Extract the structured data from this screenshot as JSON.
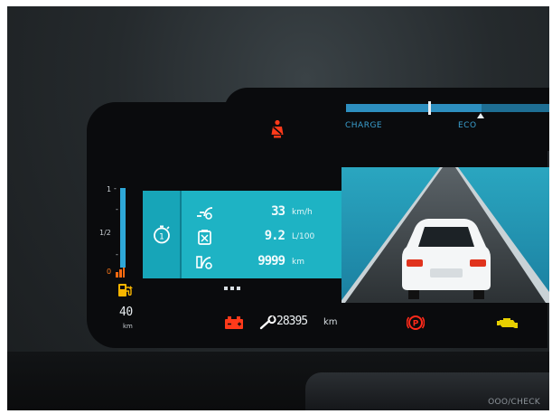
{
  "top_bar": {
    "charge_label": "CHARGE",
    "eco_label": "ECO",
    "charge_level_percent": 40
  },
  "fuel_gauge": {
    "tick_full": "1",
    "tick_half": "1/2",
    "tick_empty": "0",
    "range_value": "40",
    "range_unit": "km"
  },
  "trip": {
    "rows": [
      {
        "icon": "average-speed-icon",
        "value": "33",
        "unit": "km/h"
      },
      {
        "icon": "fuel-consumption-icon",
        "value": "9.2",
        "unit": "L/100"
      },
      {
        "icon": "range-icon",
        "value": "9999",
        "unit": "km"
      }
    ],
    "selected_trip": "1"
  },
  "status_bar": {
    "odometer_value": "28395",
    "odometer_unit": "km"
  },
  "footer": {
    "obd_label": "OOO/CHECK"
  },
  "colors": {
    "teal_panel": "#1eb3c4",
    "fuel_blue": "#2ea8d8",
    "warning_red": "#ff3a1a",
    "warning_amber": "#f7b500",
    "engine_yellow": "#e8d000"
  }
}
